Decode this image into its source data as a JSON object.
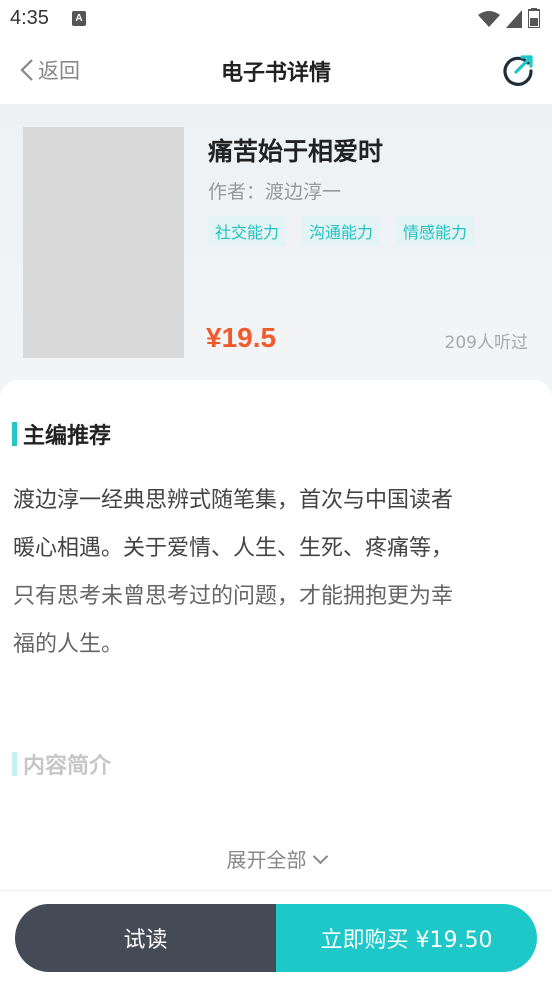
{
  "status_bar": {
    "time": "4:35",
    "notification_letter": "A"
  },
  "nav": {
    "back_label": "返回",
    "title": "电子书详情"
  },
  "book": {
    "title": "痛苦始于相爱时",
    "author": "作者：渡边淳一",
    "tags": [
      "社交能力",
      "沟通能力",
      "情感能力"
    ],
    "price": "¥19.5",
    "listened": "209人听过"
  },
  "sections": {
    "recommend_title": "主编推荐",
    "recommend_lines": [
      "渡边淳一经典思辨式随笔集，首次与中国读者",
      "暖心相遇。关于爱情、人生、生死、疼痛等，",
      "只有思考未曾思考过的问题，才能拥抱更为幸",
      "福的人生。"
    ],
    "intro_title": "内容简介",
    "expand_label": "展开全部"
  },
  "actions": {
    "trial_label": "试读",
    "buy_label": "立即购买 ¥19.50"
  },
  "colors": {
    "accent": "#1ec8c8",
    "price": "#f25a2c",
    "dark_button": "#444b57"
  }
}
